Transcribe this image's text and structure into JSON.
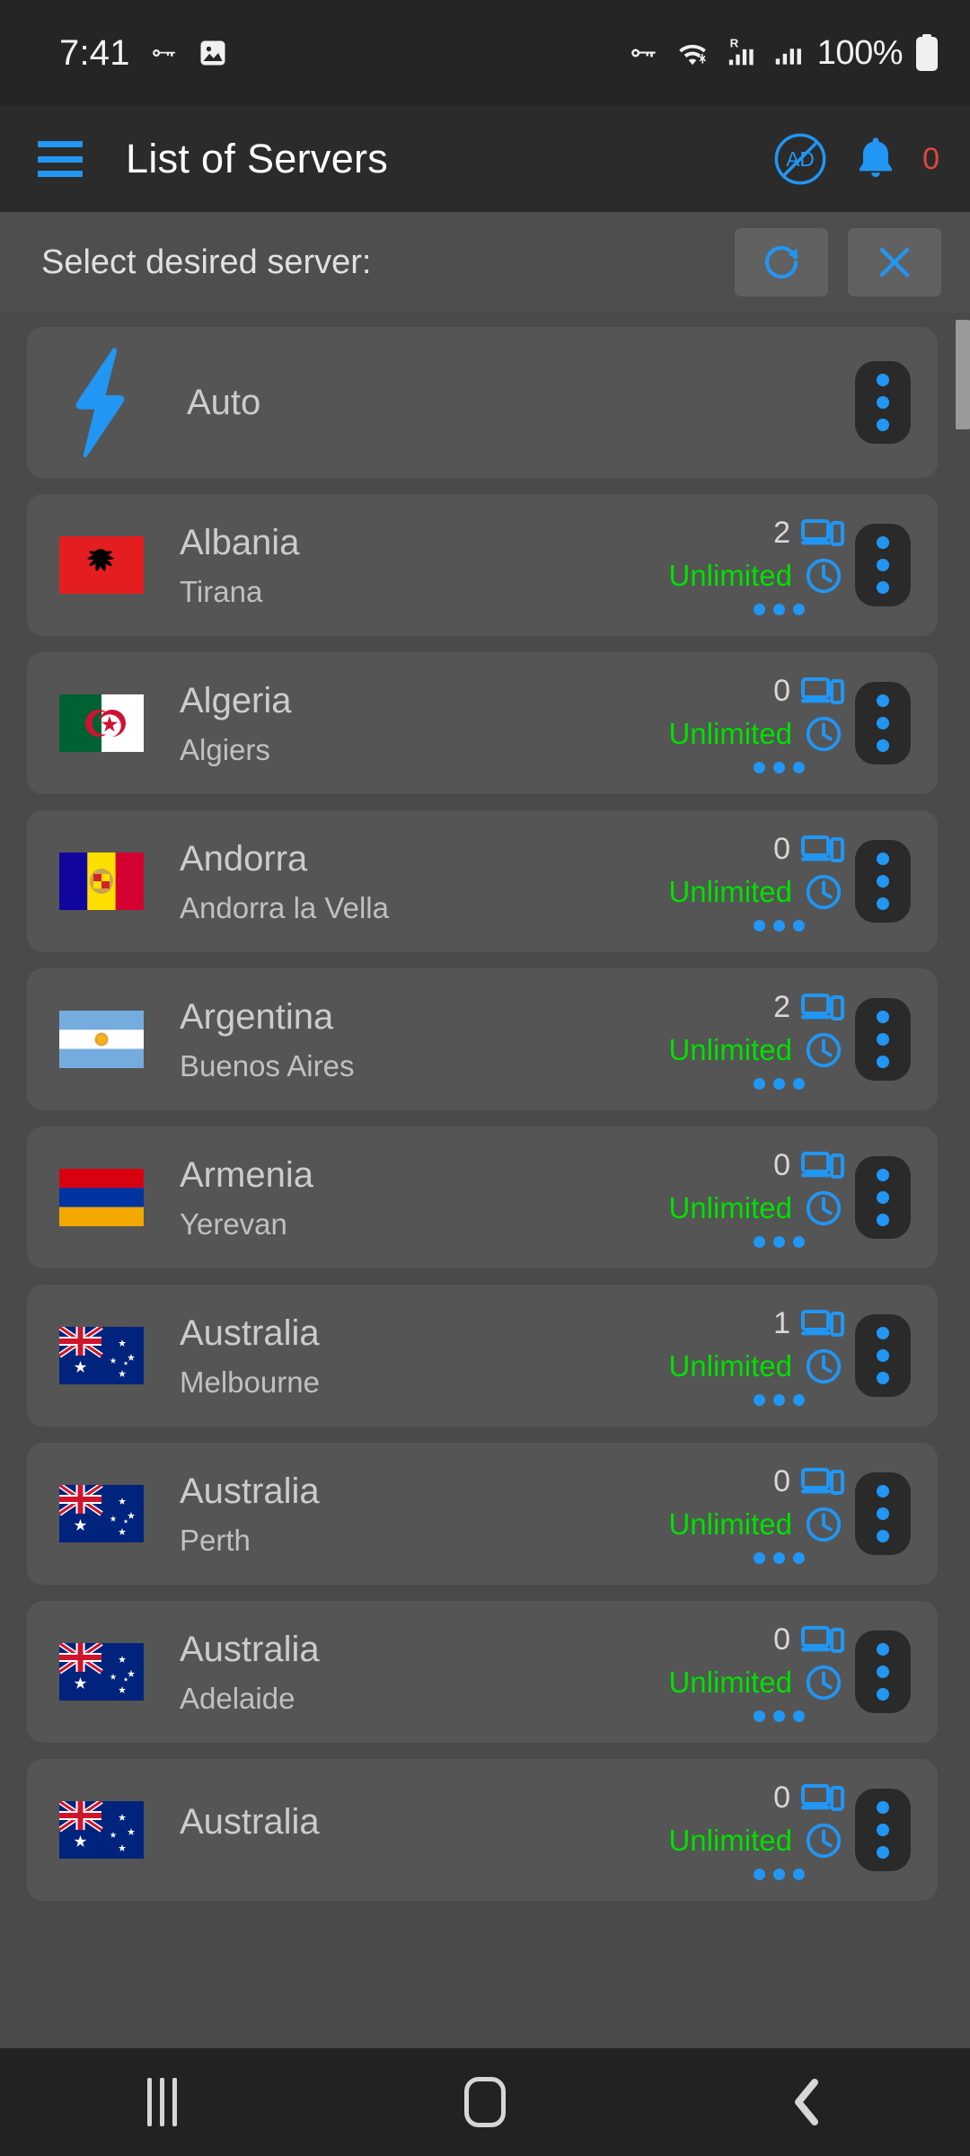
{
  "statusbar": {
    "time": "7:41",
    "battery_pct": "100%",
    "icons": [
      "vpn-key-icon",
      "image-icon",
      "vpn-key-icon",
      "wifi-icon",
      "signal-roaming-icon",
      "signal-icon",
      "battery-icon"
    ]
  },
  "appbar": {
    "menu_icon": "hamburger-menu-icon",
    "title": "List of Servers",
    "adblock_icon": "ad-block-icon",
    "bell_icon": "notification-bell-icon",
    "notification_count": "0",
    "accent": "#2196f3",
    "badge_color": "#e2473f"
  },
  "subheader": {
    "label": "Select desired server:",
    "refresh_icon": "refresh-icon",
    "close_icon": "close-icon"
  },
  "list": {
    "auto": {
      "label": "Auto",
      "icon": "lightning-bolt-icon",
      "kebab": "more-options-icon"
    },
    "unlimited_label": "Unlimited",
    "device_icon": "devices-icon",
    "clock_icon": "clock-icon",
    "signal_icon": "signal-dots-icon",
    "kebab_icon": "more-options-icon",
    "unlimited_color": "#00e000",
    "servers": [
      {
        "country": "Albania",
        "city": "Tirana",
        "devices": "2",
        "quota": "Unlimited",
        "flag": "al"
      },
      {
        "country": "Algeria",
        "city": "Algiers",
        "devices": "0",
        "quota": "Unlimited",
        "flag": "dz"
      },
      {
        "country": "Andorra",
        "city": "Andorra la Vella",
        "devices": "0",
        "quota": "Unlimited",
        "flag": "ad"
      },
      {
        "country": "Argentina",
        "city": "Buenos Aires",
        "devices": "2",
        "quota": "Unlimited",
        "flag": "ar"
      },
      {
        "country": "Armenia",
        "city": "Yerevan",
        "devices": "0",
        "quota": "Unlimited",
        "flag": "am"
      },
      {
        "country": "Australia",
        "city": "Melbourne",
        "devices": "1",
        "quota": "Unlimited",
        "flag": "au"
      },
      {
        "country": "Australia",
        "city": "Perth",
        "devices": "0",
        "quota": "Unlimited",
        "flag": "au"
      },
      {
        "country": "Australia",
        "city": "Adelaide",
        "devices": "0",
        "quota": "Unlimited",
        "flag": "au"
      },
      {
        "country": "Australia",
        "city": "",
        "devices": "0",
        "quota": "Unlimited",
        "flag": "au"
      }
    ]
  },
  "navbar": {
    "recents": "recents-icon",
    "home": "home-icon",
    "back": "back-icon"
  }
}
